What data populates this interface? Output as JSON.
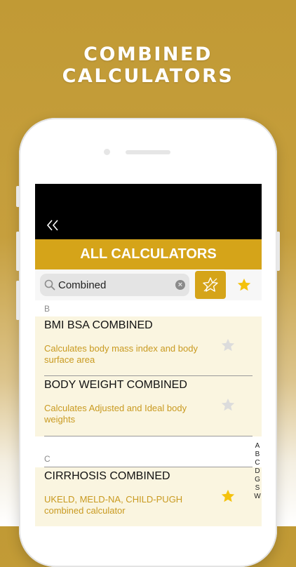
{
  "headline": "COMBINED CALCULATORS",
  "screen": {
    "back_icon": "double-chevron-left-icon",
    "title": "ALL CALCULATORS",
    "search": {
      "value": "Combined"
    },
    "sections": [
      {
        "letter": "B",
        "items": [
          {
            "title": "BMI BSA COMBINED",
            "description": "Calculates body mass index and body surface area",
            "favorite": false
          },
          {
            "title": "BODY WEIGHT COMBINED",
            "description": "Calculates Adjusted and Ideal body weights",
            "favorite": false
          }
        ]
      },
      {
        "letter": "C",
        "items": [
          {
            "title": "CIRRHOSIS COMBINED",
            "description": "UKELD, MELD-NA, CHILD-PUGH combined calculator",
            "favorite": true
          }
        ]
      }
    ],
    "index_letters": [
      "A",
      "B",
      "C",
      "D",
      "G",
      "S",
      "W"
    ]
  },
  "colors": {
    "brand_gold": "#d5a419",
    "star_active": "#f4c20d",
    "star_inactive": "#dcdcdc"
  }
}
